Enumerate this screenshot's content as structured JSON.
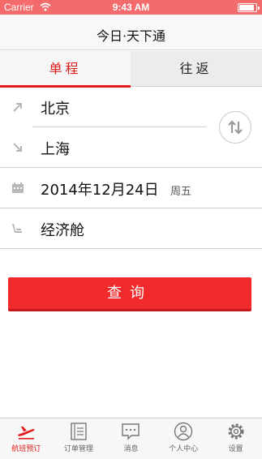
{
  "status_bar": {
    "carrier": "Carrier",
    "time": "9:43 AM",
    "battery_level": 0.9
  },
  "nav": {
    "title": "今日·天下通"
  },
  "tabs": {
    "one_way": "单程",
    "round_trip": "往返",
    "selected": "one_way"
  },
  "form": {
    "departure_city": "北京",
    "arrival_city": "上海",
    "date": "2014年12月24日",
    "weekday": "周五",
    "cabin_class": "经济舱"
  },
  "search_button": {
    "label": "查询"
  },
  "tabbar": {
    "items": [
      {
        "label": "航班预订",
        "icon": "airplane-icon",
        "active": true
      },
      {
        "label": "订单管理",
        "icon": "document-icon",
        "active": false
      },
      {
        "label": "消息",
        "icon": "message-icon",
        "active": false
      },
      {
        "label": "个人中心",
        "icon": "user-icon",
        "active": false
      },
      {
        "label": "设置",
        "icon": "gear-icon",
        "active": false
      }
    ]
  },
  "colors": {
    "accent": "#e21b1b",
    "status_bar": "#f46b6b",
    "button": "#f12b2b"
  }
}
